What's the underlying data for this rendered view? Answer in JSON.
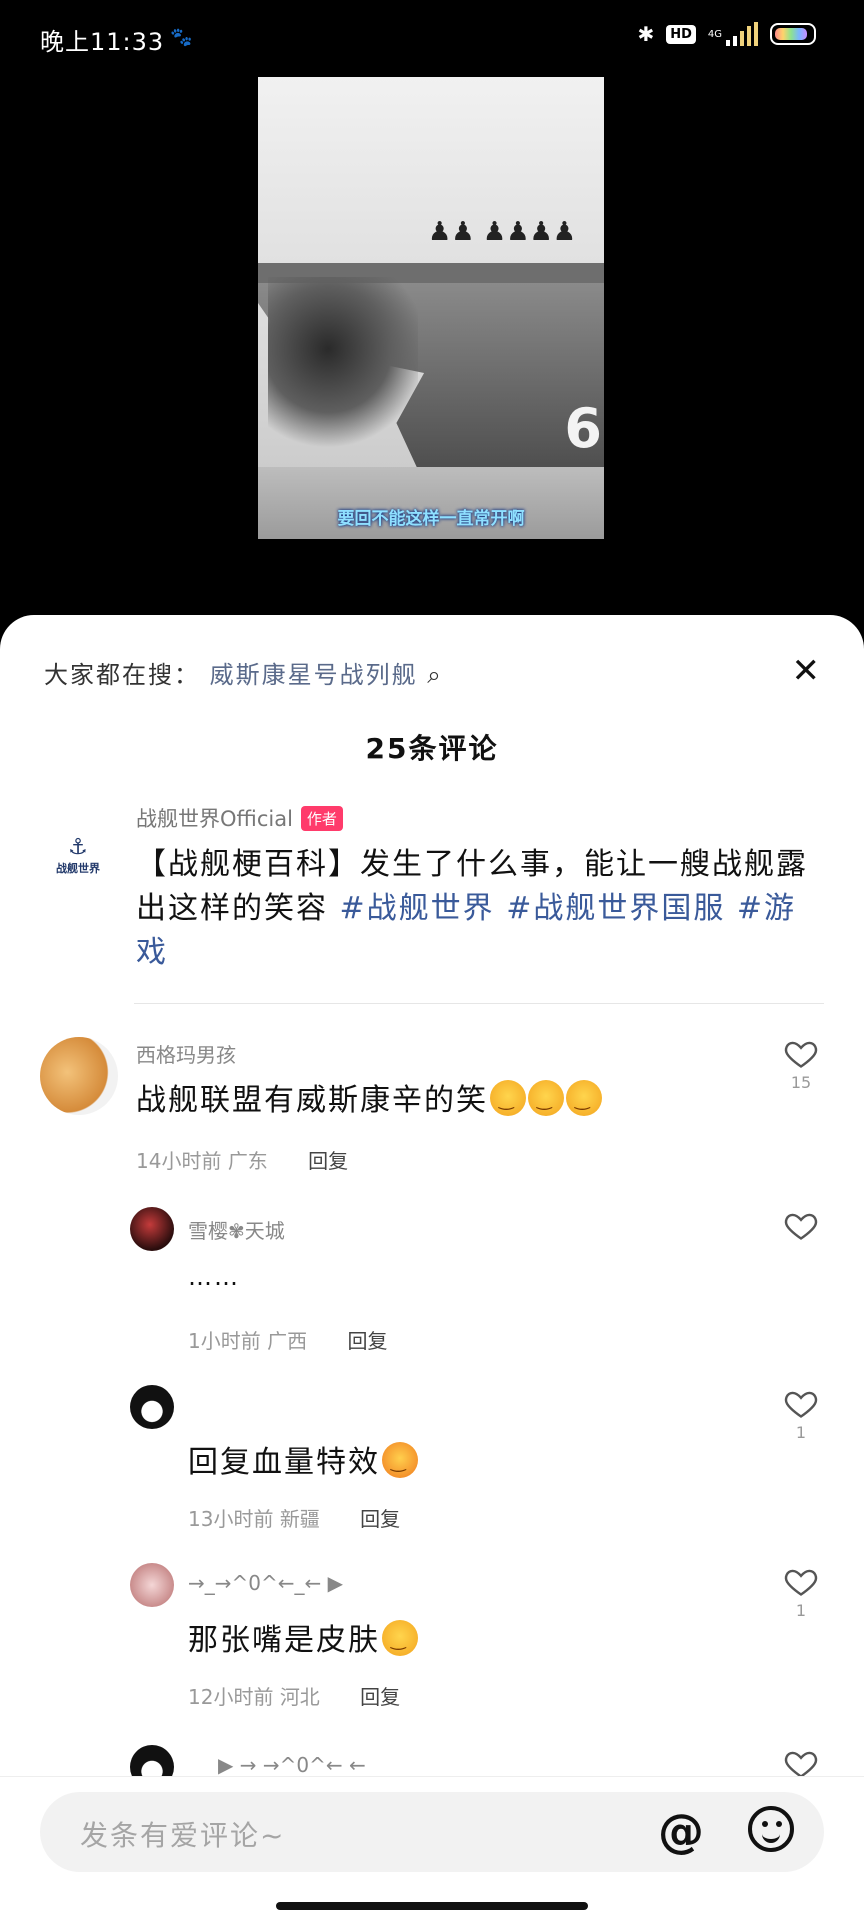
{
  "status_bar": {
    "time": "晚上11:33",
    "network": "4G",
    "hd": "HD"
  },
  "video": {
    "hull_number": "6",
    "subtitle": "要回不能这样一直常开啊"
  },
  "sheet": {
    "hot_search_prefix": "大家都在搜：",
    "hot_search_keyword": "威斯康星号战列舰",
    "comment_count": "25条评论",
    "author": {
      "logo_text": "战舰世界",
      "name": "战舰世界Official",
      "tag": "作者",
      "text": "【战舰梗百科】发生了什么事，能让一艘战舰露出这样的笑容",
      "hashtags": [
        "#战舰世界",
        "#战舰世界国服",
        "#游戏"
      ]
    },
    "comments": [
      {
        "user": "西格玛男孩",
        "text": "战舰联盟有威斯康辛的笑",
        "emoji_count": 3,
        "time": "14小时前",
        "location": "广东",
        "reply_label": "回复",
        "likes": "15"
      },
      {
        "user": "雪樱✾天城",
        "text": "……",
        "time": "1小时前",
        "location": "广西",
        "reply_label": "回复",
        "likes": ""
      },
      {
        "user": "",
        "text": "回复血量特效",
        "time": "13小时前",
        "location": "新疆",
        "reply_label": "回复",
        "likes": "1"
      },
      {
        "user": "→_→^0^←_← ▶",
        "text": "那张嘴是皮肤",
        "time": "12小时前",
        "location": "河北",
        "reply_label": "回复",
        "likes": "1"
      },
      {
        "user": "▶ → →^0^← ←",
        "text": "",
        "time": "",
        "location": "",
        "reply_label": "",
        "likes": ""
      }
    ]
  },
  "input_bar": {
    "placeholder": "发条有爱评论~",
    "at_symbol": "@"
  },
  "colors": {
    "tag_bg": "#ff3b6b",
    "hashtag": "#3a5a9a",
    "subtitle": "#8fe0ff"
  }
}
